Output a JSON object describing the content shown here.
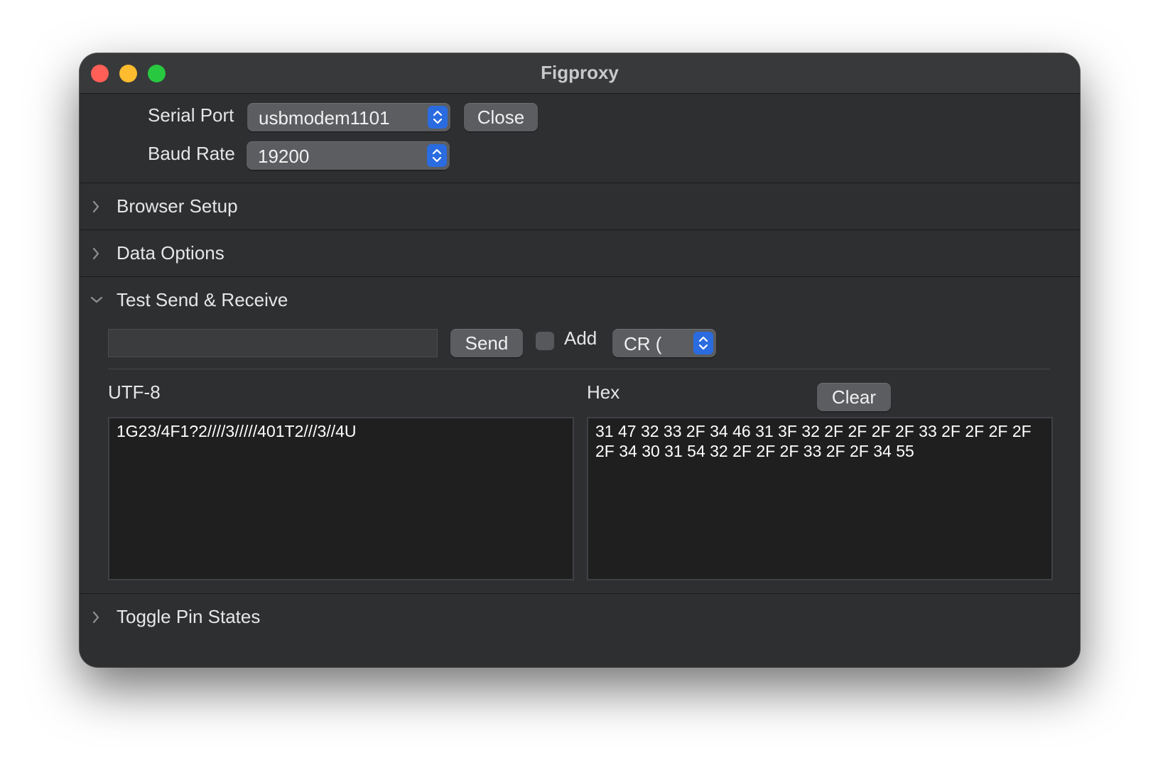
{
  "window": {
    "title": "Figproxy"
  },
  "connection": {
    "serial_port_label": "Serial Port",
    "serial_port_value": "usbmodem1101",
    "close_label": "Close",
    "baud_rate_label": "Baud Rate",
    "baud_rate_value": "19200"
  },
  "sections": {
    "browser_setup": "Browser Setup",
    "data_options": "Data Options",
    "test_send_receive": "Test Send & Receive",
    "toggle_pin_states": "Toggle Pin States"
  },
  "send": {
    "input_value": "",
    "send_label": "Send",
    "add_label": "Add",
    "add_checked": false,
    "line_ending_value": "CR ("
  },
  "receive": {
    "utf8_label": "UTF-8",
    "hex_label": "Hex",
    "clear_label": "Clear",
    "utf8_text": "1G23/4F1?2////3/////401T2///3//4U",
    "hex_text": "31 47 32 33 2F 34 46 31 3F 32 2F 2F 2F 2F 33 2F 2F 2F 2F 2F 34 30 31 54 32 2F 2F 2F 33 2F 2F 34 55"
  },
  "icons": {
    "close": "close-window-icon",
    "minimize": "minimize-window-icon",
    "zoom": "zoom-window-icon",
    "popup_stepper": "up-down-chevron-icon",
    "disclosure_collapsed": "chevron-right-icon",
    "disclosure_expanded": "chevron-down-icon"
  },
  "colors": {
    "accent": "#2a6ce0",
    "window_bg": "#2d2f31",
    "traffic_red": "#ff5f57",
    "traffic_yellow": "#febc2e",
    "traffic_green": "#28c840"
  }
}
